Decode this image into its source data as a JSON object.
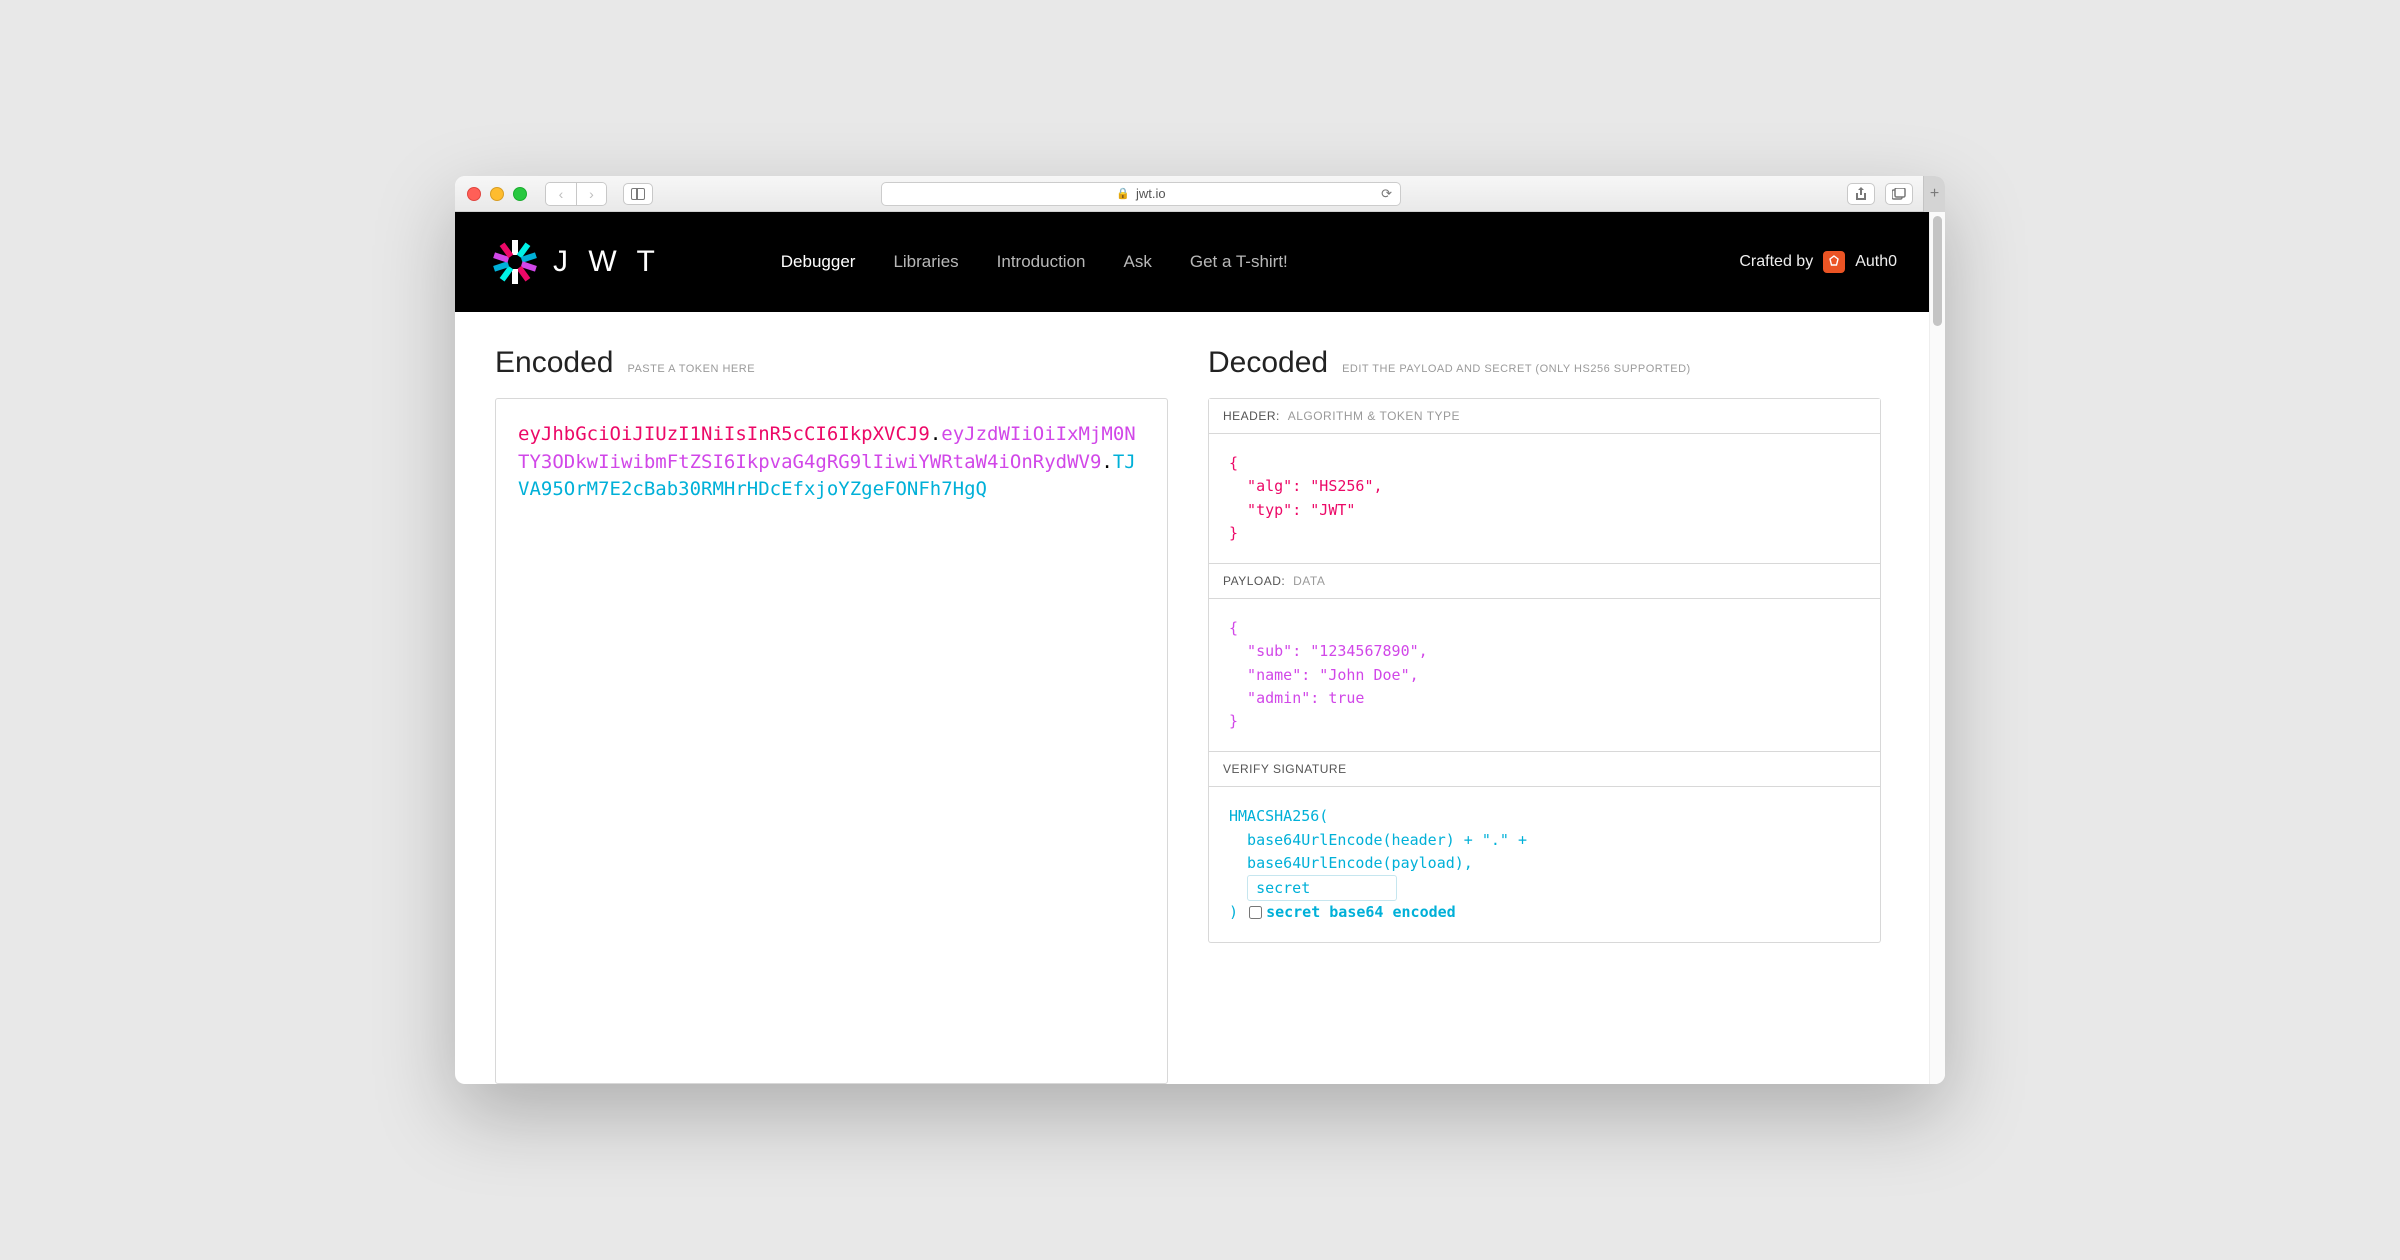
{
  "browser": {
    "url_host": "jwt.io"
  },
  "header": {
    "brand": "J W T",
    "nav": {
      "debugger": "Debugger",
      "libraries": "Libraries",
      "introduction": "Introduction",
      "ask": "Ask",
      "tshirt": "Get a T-shirt!"
    },
    "crafted_label": "Crafted by",
    "crafted_brand": "Auth0"
  },
  "encoded": {
    "title": "Encoded",
    "subtitle": "PASTE A TOKEN HERE",
    "token_header": "eyJhbGciOiJIUzI1NiIsInR5cCI6IkpXVCJ9",
    "token_payload": "eyJzdWIiOiIxMjM0NTY3ODkwIiwibmFtZSI6IkpvaG4gRG9lIiwiYWRtaW4iOnRydWV9",
    "token_signature": "TJVA95OrM7E2cBab30RMHrHDcEfxjoYZgeFONFh7HgQ"
  },
  "decoded": {
    "title": "Decoded",
    "subtitle": "EDIT THE PAYLOAD AND SECRET (ONLY HS256 SUPPORTED)",
    "header_section": {
      "label": "HEADER:",
      "meta": "ALGORITHM & TOKEN TYPE",
      "body": "{\n  \"alg\": \"HS256\",\n  \"typ\": \"JWT\"\n}"
    },
    "payload_section": {
      "label": "PAYLOAD:",
      "meta": "DATA",
      "body": "{\n  \"sub\": \"1234567890\",\n  \"name\": \"John Doe\",\n  \"admin\": true\n}"
    },
    "signature_section": {
      "label": "VERIFY SIGNATURE",
      "line1": "HMACSHA256(",
      "line2": "  base64UrlEncode(header) + \".\" +",
      "line3": "  base64UrlEncode(payload),",
      "secret_value": "secret",
      "close_paren": ") ",
      "b64_label": "secret base64 encoded"
    }
  }
}
